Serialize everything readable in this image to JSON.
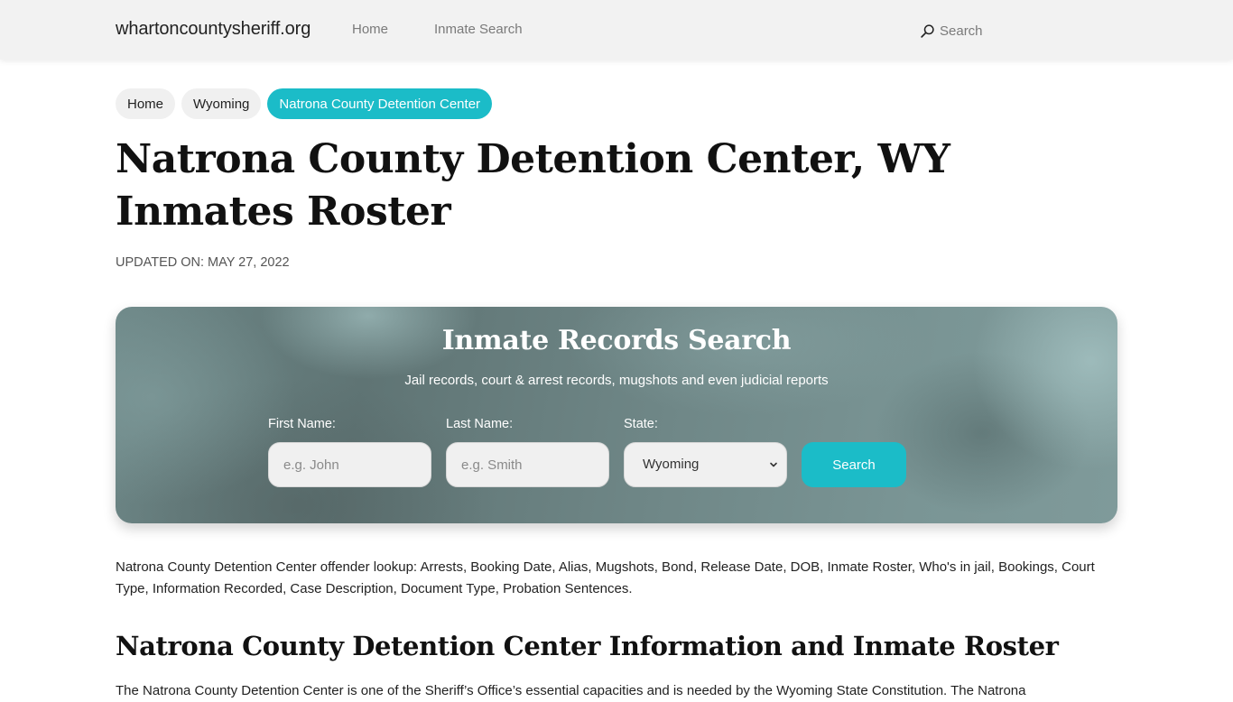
{
  "navbar": {
    "brand": "whartoncountysheriff.org",
    "links": [
      {
        "label": "Home"
      },
      {
        "label": "Inmate Search"
      }
    ],
    "search": {
      "icon": "search-icon",
      "label": "Search"
    }
  },
  "breadcrumb": [
    {
      "label": "Home",
      "active": false
    },
    {
      "label": "Wyoming",
      "active": false
    },
    {
      "label": "Natrona County Detention Center",
      "active": true
    }
  ],
  "page": {
    "title": "Natrona County Detention Center, WY Inmates Roster",
    "updated": "UPDATED ON: MAY 27, 2022"
  },
  "search_panel": {
    "title": "Inmate Records Search",
    "subtitle": "Jail records, court & arrest records, mugshots and even judicial reports",
    "first_name": {
      "label": "First Name:",
      "placeholder": "e.g. John",
      "value": ""
    },
    "last_name": {
      "label": "Last Name:",
      "placeholder": "e.g. Smith",
      "value": ""
    },
    "state": {
      "label": "State:",
      "selected": "Wyoming",
      "icon": "chevron-down-icon"
    },
    "button_label": "Search"
  },
  "content": {
    "intro": "Natrona County Detention Center offender lookup: Arrests, Booking Date, Alias, Mugshots, Bond, Release Date, DOB, Inmate Roster, Who's in jail, Bookings, Court Type, Information Recorded, Case Description, Document Type, Probation Sentences.",
    "section_heading": "Natrona County Detention Center Information and Inmate Roster",
    "section_text": "The Natrona County Detention Center is one of the Sheriff’s Office’s essential capacities and is needed by the Wyoming State Constitution. The Natrona"
  },
  "colors": {
    "accent": "#1bbcc8",
    "navbar_bg": "#f2f2f2",
    "panel_bg": "#6f8787"
  }
}
